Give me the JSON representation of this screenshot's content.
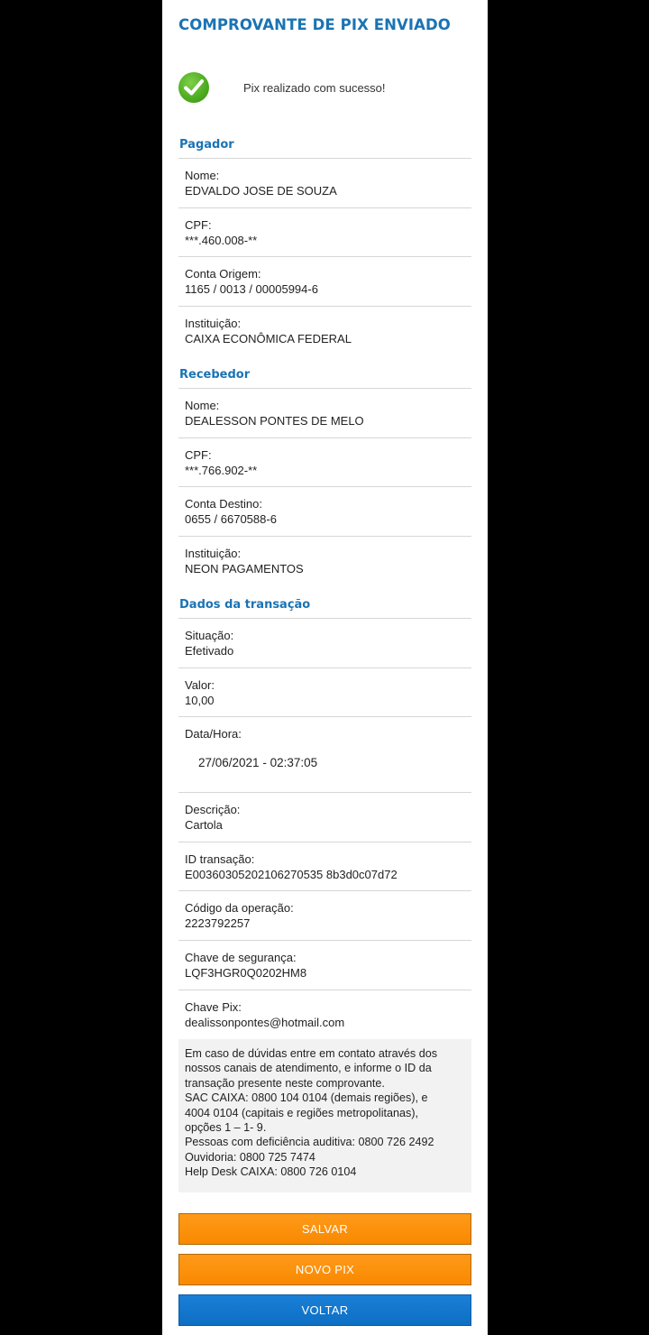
{
  "header": {
    "title": "COMPROVANTE DE PIX ENVIADO"
  },
  "status": {
    "message": "Pix realizado com sucesso!",
    "icon": "check-circle-icon",
    "color": "#4fae22"
  },
  "pagador": {
    "title": "Pagador",
    "nome_label": "Nome:",
    "nome": "EDVALDO JOSE DE SOUZA",
    "cpf_label": "CPF:",
    "cpf": "***.460.008-**",
    "conta_label": "Conta Origem:",
    "conta": "1165 / 0013 / 00005994-6",
    "instituicao_label": "Instituição:",
    "instituicao": "CAIXA ECONÔMICA FEDERAL"
  },
  "recebedor": {
    "title": "Recebedor",
    "nome_label": "Nome:",
    "nome": "DEALESSON PONTES DE MELO",
    "cpf_label": "CPF:",
    "cpf": "***.766.902-**",
    "conta_label": "Conta Destino:",
    "conta": "0655 / 6670588-6",
    "instituicao_label": "Instituição:",
    "instituicao": "NEON PAGAMENTOS"
  },
  "transacao": {
    "title": "Dados da transação",
    "situacao_label": "Situação:",
    "situacao": "Efetivado",
    "valor_label": "Valor:",
    "valor": "10,00",
    "data_label": "Data/Hora:",
    "data": "27/06/2021 - 02:37:05",
    "descricao_label": "Descrição:",
    "descricao": "Cartola",
    "id_label": "ID transação:",
    "id": "E00360305202106270535 8b3d0c07d72",
    "codigo_label": "Código da operação:",
    "codigo": "2223792257",
    "chave_seg_label": "Chave de segurança:",
    "chave_seg": "LQF3HGR0Q0202HM8",
    "chave_pix_label": "Chave Pix:",
    "chave_pix": "dealissonpontes@hotmail.com"
  },
  "info": {
    "lines": [
      "Em caso de dúvidas entre em contato através dos",
      "nossos canais de atendimento, e informe o ID da",
      "transação presente neste comprovante.",
      "SAC CAIXA: 0800 104 0104 (demais regiões), e",
      "4004 0104 (capitais e regiões metropolitanas),",
      "opções 1 – 1- 9.",
      "Pessoas com deficiência auditiva: 0800 726 2492",
      "Ouvidoria: 0800 725 7474",
      "Help Desk CAIXA: 0800 726 0104"
    ]
  },
  "buttons": {
    "salvar": "SALVAR",
    "novo_pix": "NOVO PIX",
    "voltar": "VOLTAR"
  },
  "colors": {
    "accent": "#1a73b4",
    "orange": "#f98900",
    "blue": "#0d6fc4"
  }
}
